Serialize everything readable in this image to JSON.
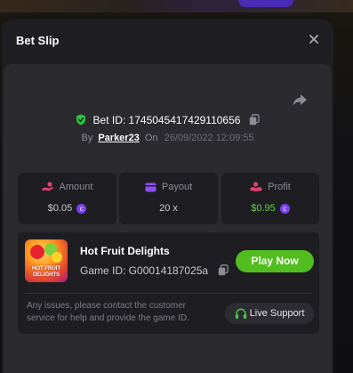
{
  "modal": {
    "title": "Bet Slip"
  },
  "bet": {
    "id_label": "Bet ID: 1745045417429110656",
    "by_label": "By",
    "username": "Parker23",
    "on_label": "On",
    "timestamp": "26/09/2022 12:09:55"
  },
  "stats": [
    {
      "label": "Amount",
      "value": "$0.05",
      "icon": "coins-hand-icon",
      "color": "#e0406e"
    },
    {
      "label": "Payout",
      "value": "20 x",
      "icon": "wallet-icon",
      "color": "#8a4ff0"
    },
    {
      "label": "Profit",
      "value": "$0.95",
      "icon": "profit-hand-icon",
      "color": "#e0406e"
    }
  ],
  "coin_symbol": "c",
  "game": {
    "thumbnail_text": "HOT FRUIT DELIGHTS",
    "name": "Hot Fruit Delights",
    "id_label": "Game ID: G00014187025a",
    "play_label": "Play Now",
    "note": "Any issues, please contact the customer service for help and provide the game ID.",
    "support_label": "Live Support"
  },
  "colors": {
    "accent_green": "#52bd1e",
    "profit_green": "#5fd33a",
    "coin_purple": "#7b3ff2",
    "verified_green": "#2fc23a"
  }
}
